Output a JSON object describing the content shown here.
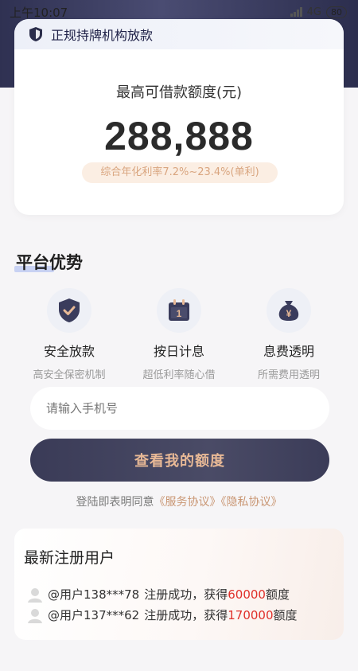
{
  "status_bar": {
    "time": "上午10:07",
    "network": "4G",
    "battery": "80"
  },
  "hero": {
    "license_text": "正规持牌机构放款",
    "quota_label": "最高可借款额度(元)",
    "quota_amount": "288,888",
    "rate_text": "综合年化利率7.2%~23.4%(单利)"
  },
  "advantages": {
    "title": "平台优势",
    "items": [
      {
        "icon": "shield-check-icon",
        "title": "安全放款",
        "desc": "高安全保密机制"
      },
      {
        "icon": "calendar-icon",
        "title": "按日计息",
        "desc": "超低利率随心借"
      },
      {
        "icon": "money-bag-icon",
        "title": "息费透明",
        "desc": "所需费用透明"
      }
    ]
  },
  "form": {
    "phone_placeholder": "请输入手机号",
    "submit_label": "查看我的额度",
    "agree_prefix": "登陆即表明同意",
    "service_agreement": "《服务协议》",
    "privacy_agreement": "《隐私协议》"
  },
  "latest_users": {
    "title": "最新注册用户",
    "rows": [
      {
        "user": "@用户138***78",
        "middle": "注册成功，获得",
        "amount": "60000",
        "suffix": "额度"
      },
      {
        "user": "@用户137***62",
        "middle": "注册成功，获得",
        "amount": "170000",
        "suffix": "额度"
      }
    ]
  },
  "colors": {
    "accent_gold": "#e8b996",
    "navy": "#3a3b57",
    "highlight_red": "#e0302a"
  }
}
